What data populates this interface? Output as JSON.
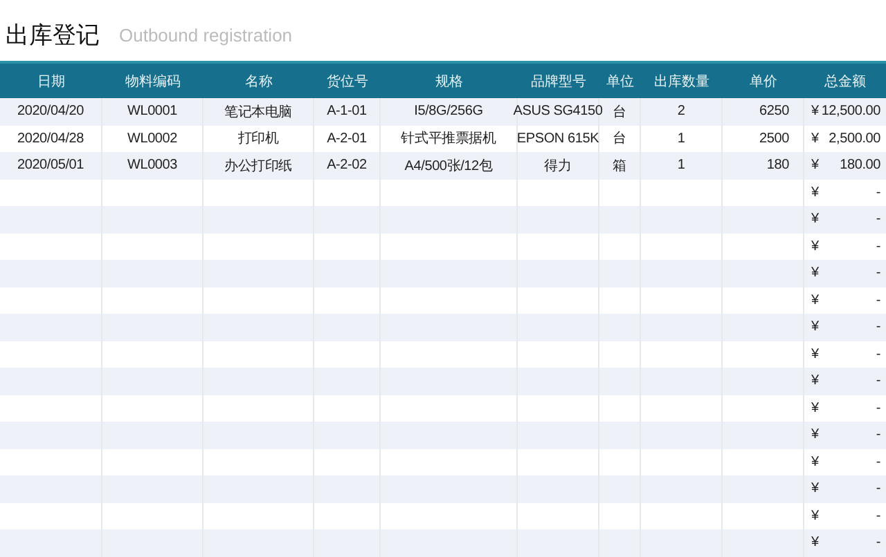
{
  "title": "出库登记",
  "subtitle": "Outbound registration",
  "columns": [
    "日期",
    "物料编码",
    "名称",
    "货位号",
    "规格",
    "品牌型号",
    "单位",
    "出库数量",
    "单价",
    "总金额"
  ],
  "rows": [
    {
      "cells": [
        "2020/04/20",
        "WL0001",
        "笔记本电脑",
        "A-1-01",
        "I5/8G/256G",
        "ASUS SG4150",
        "台",
        "2",
        "6250"
      ],
      "currency": "¥",
      "total": "12,500.00"
    },
    {
      "cells": [
        "2020/04/28",
        "WL0002",
        "打印机",
        "A-2-01",
        "针式平推票据机",
        "EPSON 615K",
        "台",
        "1",
        "2500"
      ],
      "currency": "¥",
      "total": "2,500.00"
    },
    {
      "cells": [
        "2020/05/01",
        "WL0003",
        "办公打印纸",
        "A-2-02",
        "A4/500张/12包",
        "得力",
        "箱",
        "1",
        "180"
      ],
      "currency": "¥",
      "total": "180.00"
    },
    {
      "currency": "¥",
      "total": "-"
    },
    {
      "currency": "¥",
      "total": "-"
    },
    {
      "currency": "¥",
      "total": "-"
    },
    {
      "currency": "¥",
      "total": "-"
    },
    {
      "currency": "¥",
      "total": "-"
    },
    {
      "currency": "¥",
      "total": "-"
    },
    {
      "currency": "¥",
      "total": "-"
    },
    {
      "currency": "¥",
      "total": "-"
    },
    {
      "currency": "¥",
      "total": "-"
    },
    {
      "currency": "¥",
      "total": "-"
    },
    {
      "currency": "¥",
      "total": "-"
    },
    {
      "currency": "¥",
      "total": "-"
    },
    {
      "currency": "¥",
      "total": "-"
    },
    {
      "currency": "¥",
      "total": "-"
    }
  ]
}
